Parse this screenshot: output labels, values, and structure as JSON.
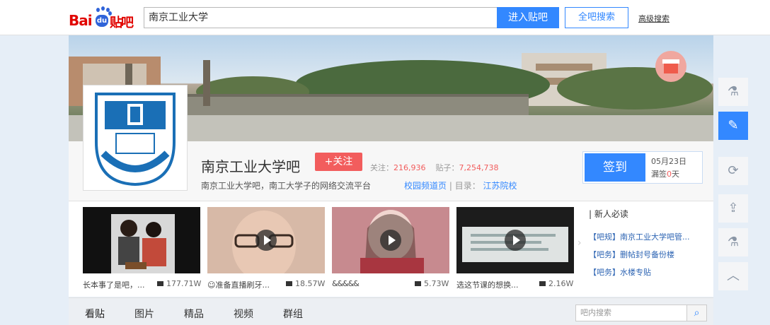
{
  "header": {
    "logo_bai": "Bai",
    "logo_du": "du",
    "logo_tieba": "贴吧",
    "search_value": "南京工业大学",
    "enter_button": "进入贴吧",
    "all_search_button": "全吧搜索",
    "advanced_search": "高级搜索"
  },
  "forum": {
    "name": "南京工业大学吧",
    "follow_button": "+关注",
    "followers_label": "关注：",
    "followers": "216,936",
    "posts_label": "贴子：",
    "posts": "7,254,738",
    "slogan": "南京工业大学吧，南工大学子的网络交流平台",
    "channel_link": "校园频道页",
    "catalog_label": "| 目录：",
    "catalog_link": "江苏院校"
  },
  "sign": {
    "button": "签到",
    "date": "05月23日",
    "missed_prefix": "漏签",
    "missed_days": "0",
    "missed_suffix": "天"
  },
  "videos": [
    {
      "caption": "长本事了是吧，...",
      "views": "177.71W"
    },
    {
      "caption": "☺准备直播刷牙...",
      "views": "18.57W"
    },
    {
      "caption": "&&&&&",
      "views": "5.73W"
    },
    {
      "caption": "选这节课的想换...",
      "views": "2.16W"
    }
  ],
  "newbie": {
    "title": "| 新人必读",
    "items": [
      "【吧规】南京工业大学吧管...",
      "【吧务】删帖封号备份楼",
      "【吧务】水楼专贴"
    ]
  },
  "tabs": [
    "看贴",
    "图片",
    "精品",
    "视频",
    "群组"
  ],
  "tab_search_placeholder": "吧内搜索",
  "colors": {
    "accent": "#3388ff",
    "follow": "#f25d5d",
    "sign_missed": "#f25d5d"
  }
}
